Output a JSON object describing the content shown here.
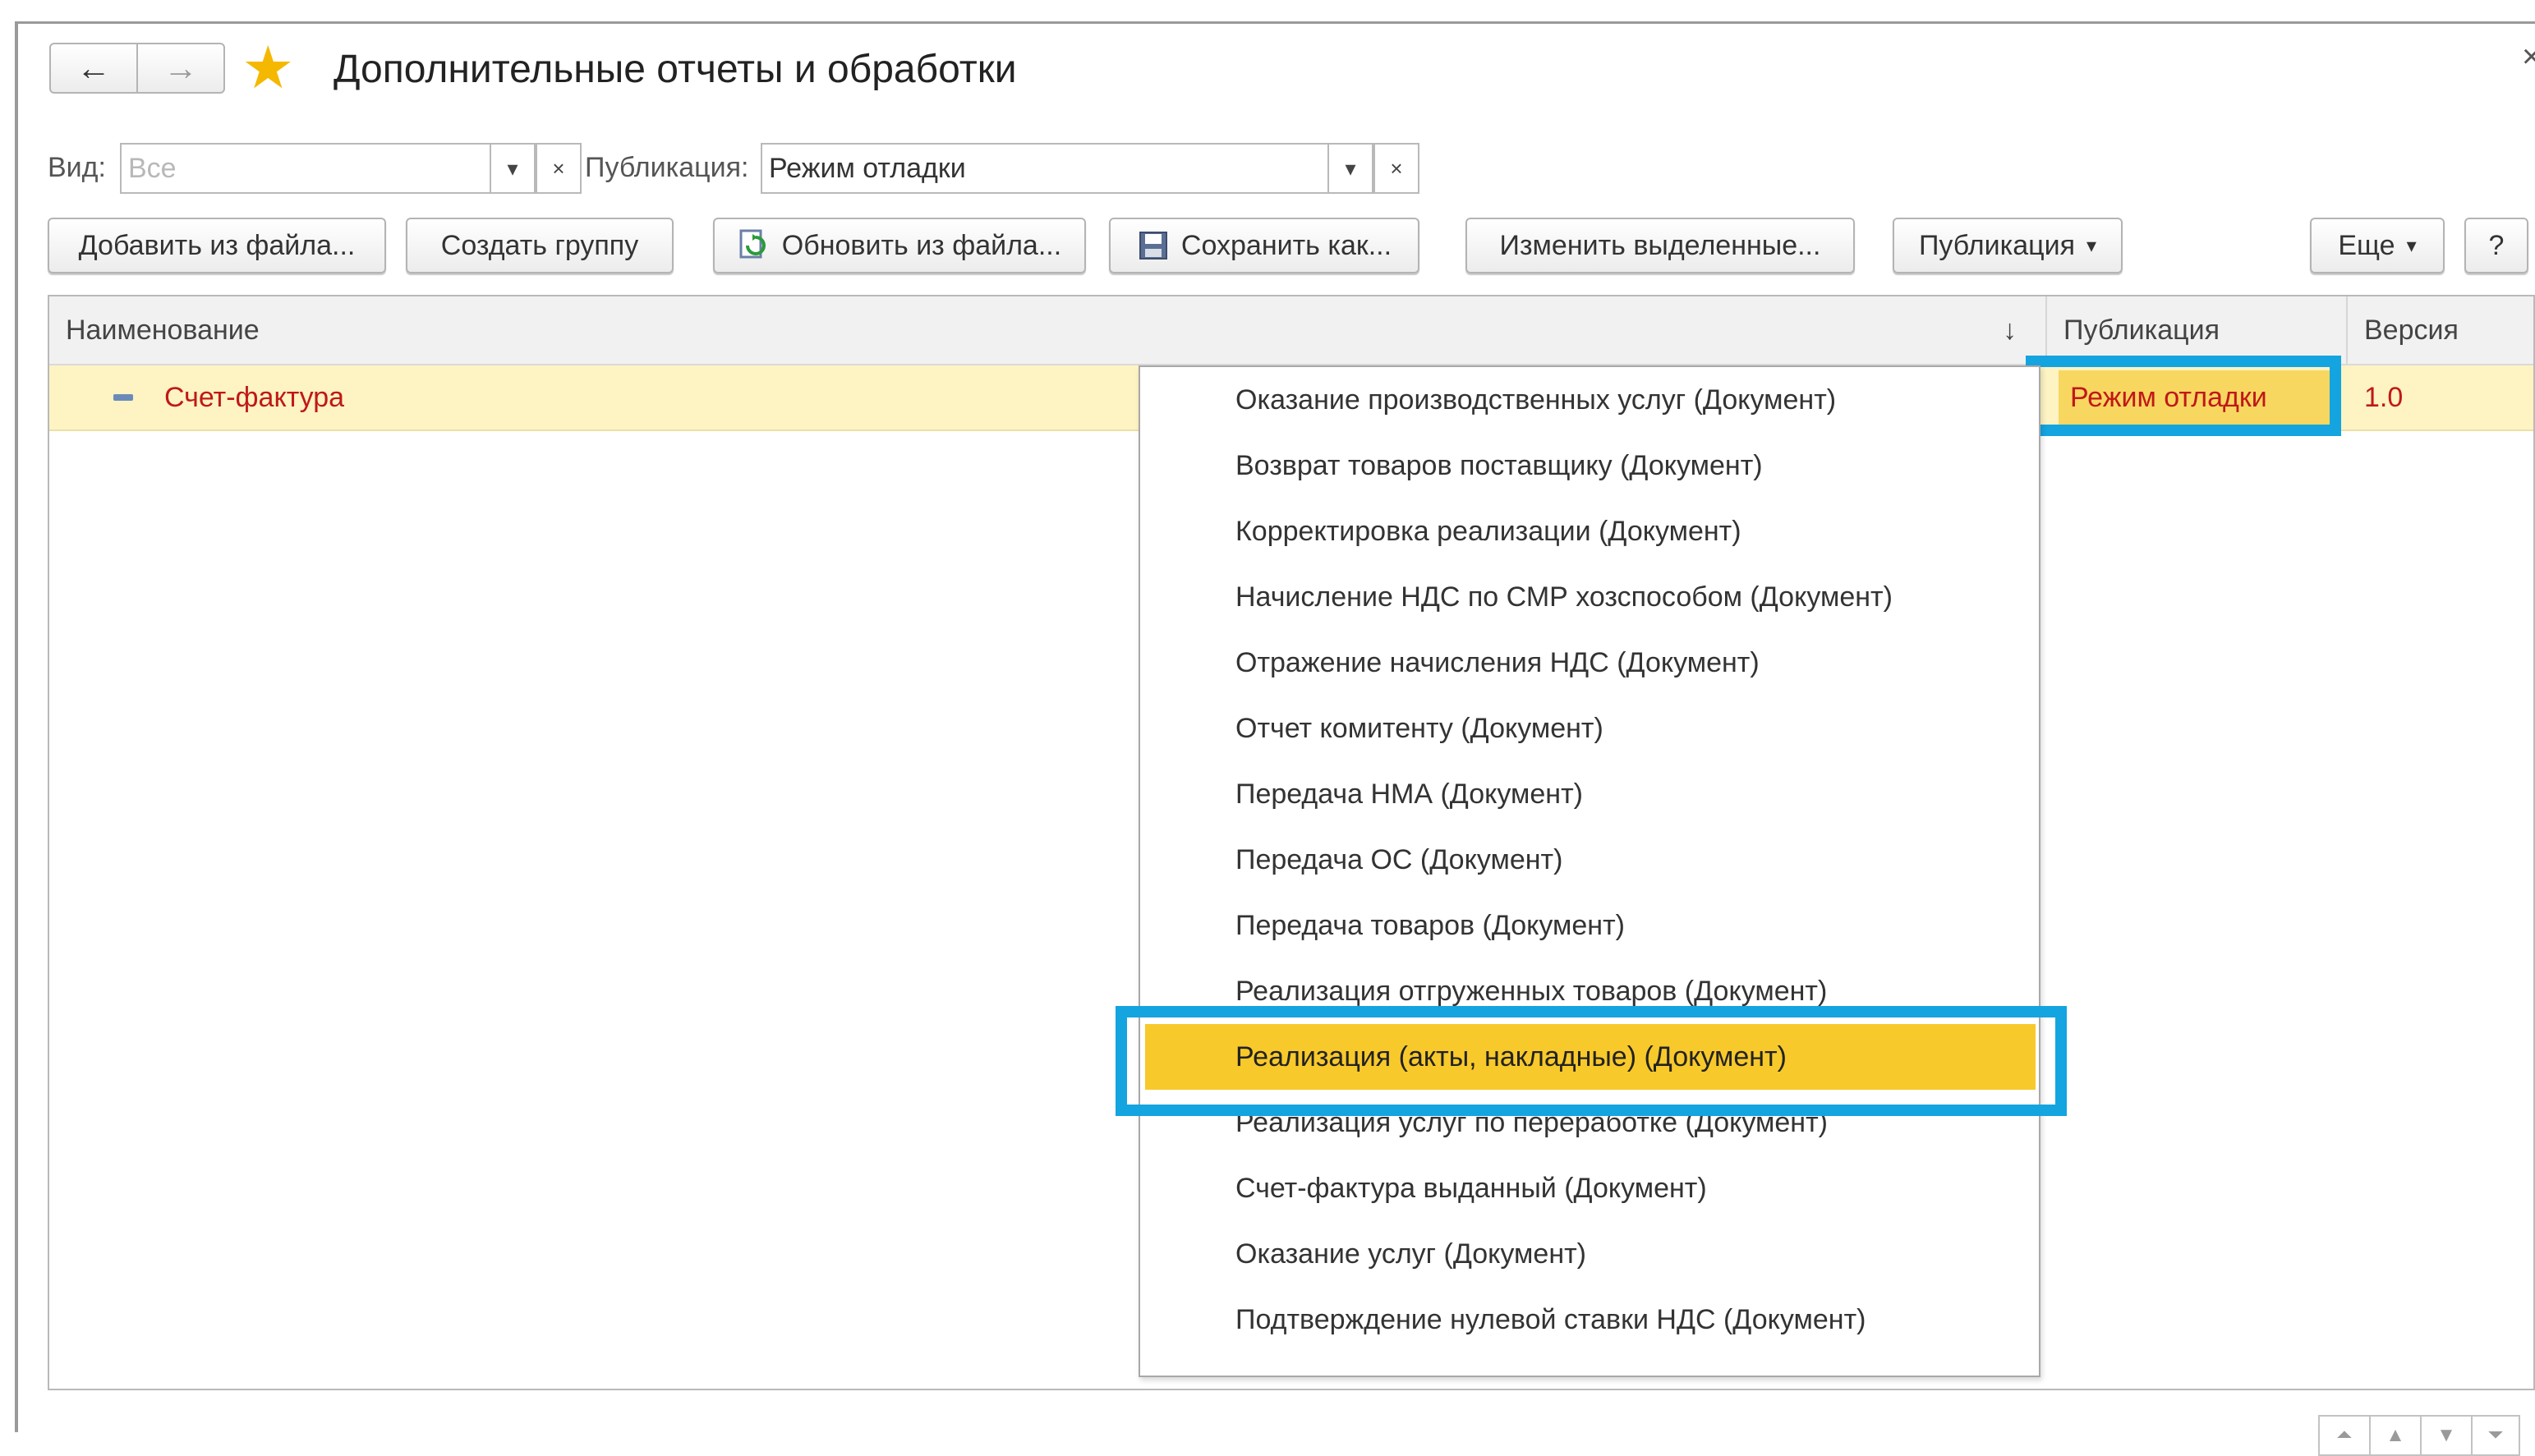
{
  "window": {
    "title": "Дополнительные отчеты и обработки",
    "back_icon": "←",
    "forward_icon": "→",
    "favorite_icon": "★",
    "close_icon": "×"
  },
  "filters": {
    "kind_label": "Вид:",
    "kind_placeholder": "Все",
    "publication_label": "Публикация:",
    "publication_value": "Режим отладки",
    "dropdown_icon": "▾",
    "clear_icon": "×"
  },
  "toolbar": {
    "add_from_file": "Добавить из файла...",
    "create_group": "Создать группу",
    "update_from_file": "Обновить из файла...",
    "save_as": "Сохранить как...",
    "change_selected": "Изменить выделенные...",
    "publication_menu": "Публикация",
    "more_menu": "Еще",
    "help": "?",
    "menu_arrow": "▾"
  },
  "table": {
    "columns": {
      "name": "Наименование",
      "publication": "Публикация",
      "version": "Версия",
      "sort_icon": "↓"
    },
    "rows": [
      {
        "name": "Счет-фактура",
        "publication": "Режим отладки",
        "version": "1.0"
      }
    ]
  },
  "dropdown": {
    "items": [
      "Оказание производственных услуг (Документ)",
      "Возврат товаров поставщику (Документ)",
      "Корректировка реализации (Документ)",
      "Начисление НДС по СМР хозспособом (Документ)",
      "Отражение начисления НДС (Документ)",
      "Отчет комитенту (Документ)",
      "Передача НМА (Документ)",
      "Передача ОС (Документ)",
      "Передача товаров (Документ)",
      "Реализация отгруженных товаров (Документ)",
      "Реализация (акты, накладные) (Документ)",
      "Реализация услуг по переработке (Документ)",
      "Счет-фактура выданный (Документ)",
      "Оказание услуг (Документ)",
      "Подтверждение нулевой ставки НДС (Документ)"
    ],
    "selected_index": 10
  },
  "pager": {
    "first": "⏶",
    "up": "▲",
    "down": "▼",
    "last": "⏷"
  },
  "colors": {
    "accent_highlight": "#14a4e0",
    "selection": "#f8c92a",
    "row_highlight": "#fdf3c3",
    "red_text": "#c01818"
  }
}
